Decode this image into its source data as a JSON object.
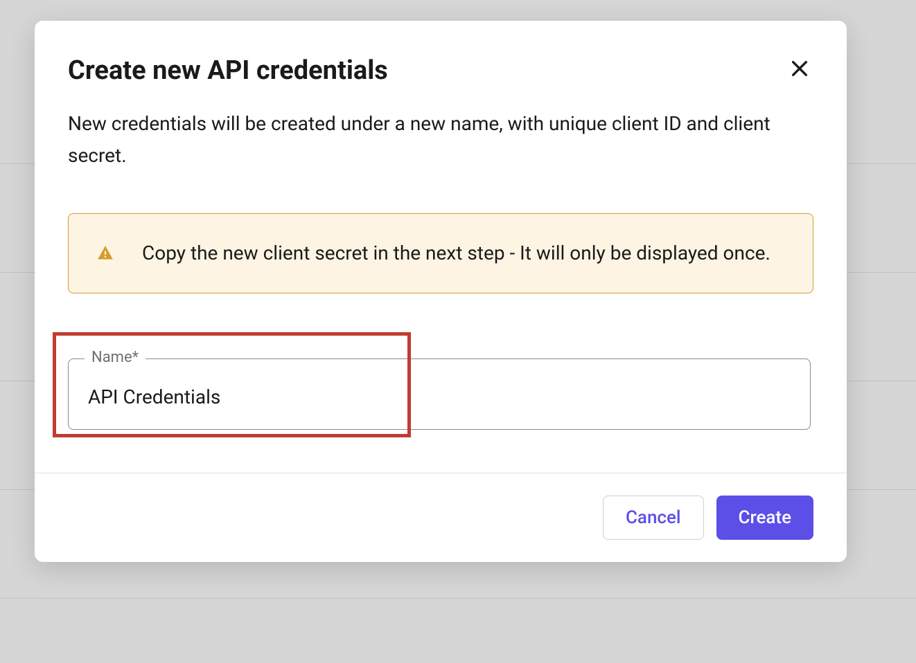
{
  "modal": {
    "title": "Create new API credentials",
    "description": "New credentials will be created under a new name, with unique client ID and client secret.",
    "alert": {
      "text": "Copy the new client secret in the next step - It will only be displayed once."
    },
    "input": {
      "label": "Name*",
      "value": "API Credentials"
    },
    "footer": {
      "cancel": "Cancel",
      "create": "Create"
    }
  }
}
